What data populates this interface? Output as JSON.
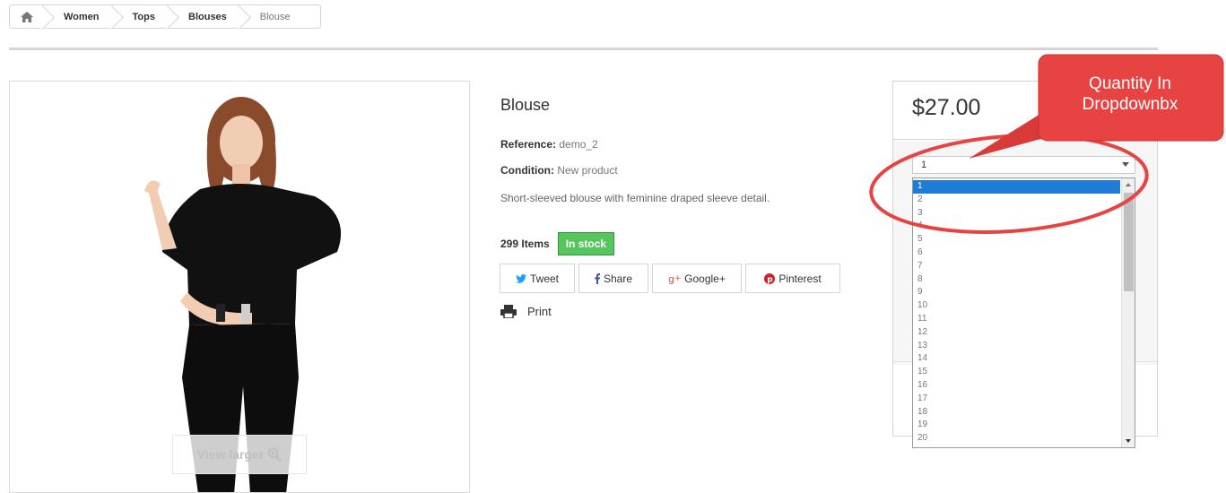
{
  "breadcrumb": {
    "home_icon": "home-icon",
    "items": [
      "Women",
      "Tops",
      "Blouses",
      "Blouse"
    ]
  },
  "product": {
    "title": "Blouse",
    "reference_label": "Reference:",
    "reference_value": "demo_2",
    "condition_label": "Condition:",
    "condition_value": "New product",
    "description": "Short-sleeved blouse with feminine draped sleeve detail.",
    "items_count": "299 Items",
    "stock_status": "In stock",
    "view_larger": "View larger",
    "print_label": "Print"
  },
  "share": {
    "tweet": "Tweet",
    "share": "Share",
    "google": "Google+",
    "pinterest": "Pinterest"
  },
  "buy_box": {
    "price": "$27.00",
    "quantity_value": "1",
    "quantity_options": [
      "1",
      "2",
      "3",
      "4",
      "5",
      "6",
      "7",
      "8",
      "9",
      "10",
      "11",
      "12",
      "13",
      "14",
      "15",
      "16",
      "17",
      "18",
      "19",
      "20"
    ],
    "selected_option": "1"
  },
  "annotation": {
    "line1": "Quantity In",
    "line2": "Dropdownbx"
  },
  "colors": {
    "in_stock": "#55c65e",
    "selected_option": "#1e7cd6",
    "callout": "#e84343"
  }
}
